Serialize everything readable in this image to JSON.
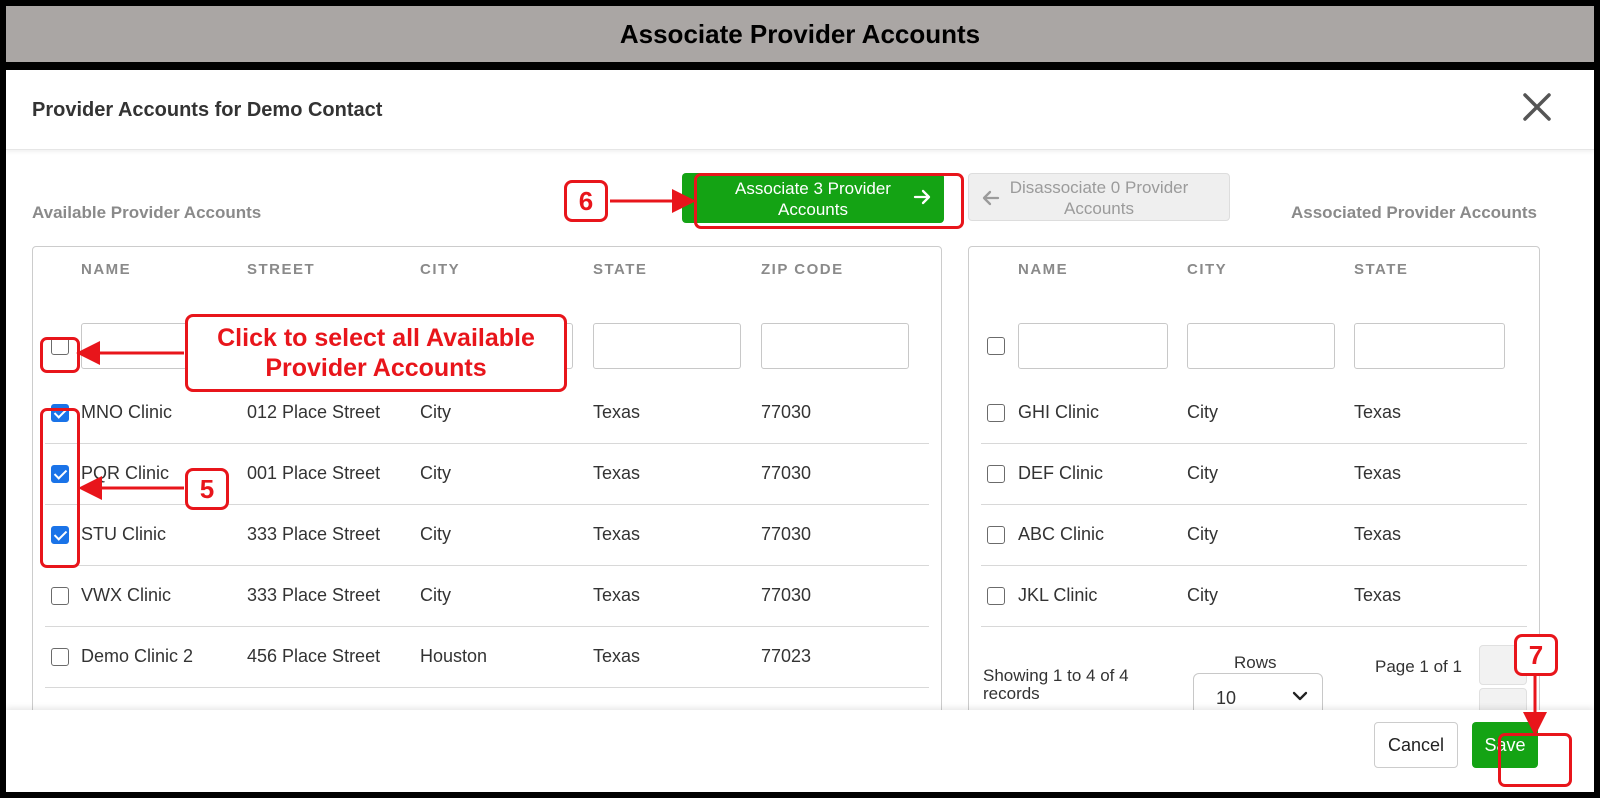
{
  "banner": {
    "title": "Associate Provider Accounts"
  },
  "dialog": {
    "title": "Provider Accounts for Demo Contact",
    "close_icon": "close-icon"
  },
  "available": {
    "label": "Available Provider Accounts",
    "columns": [
      "NAME",
      "STREET",
      "CITY",
      "STATE",
      "ZIP CODE"
    ],
    "rows": [
      {
        "name": "MNO Clinic",
        "street": "012 Place Street",
        "city": "City",
        "state": "Texas",
        "zip": "77030",
        "checked": true
      },
      {
        "name": "PQR Clinic",
        "street": "001 Place Street",
        "city": "City",
        "state": "Texas",
        "zip": "77030",
        "checked": true
      },
      {
        "name": "STU Clinic",
        "street": "333 Place Street",
        "city": "City",
        "state": "Texas",
        "zip": "77030",
        "checked": true
      },
      {
        "name": "VWX Clinic",
        "street": "333 Place Street",
        "city": "City",
        "state": "Texas",
        "zip": "77030",
        "checked": false
      },
      {
        "name": "Demo Clinic 2",
        "street": "456 Place Street",
        "city": "Houston",
        "state": "Texas",
        "zip": "77023",
        "checked": false
      }
    ]
  },
  "associate_button": {
    "label": "Associate 3 Provider Accounts",
    "icon": "arrow-right-icon"
  },
  "disassociate_button": {
    "label": "Disassociate 0 Provider Accounts",
    "icon": "arrow-left-icon"
  },
  "associated": {
    "label": "Associated Provider Accounts",
    "columns": [
      "NAME",
      "CITY",
      "STATE"
    ],
    "rows": [
      {
        "name": "GHI Clinic",
        "city": "City",
        "state": "Texas",
        "checked": false
      },
      {
        "name": "DEF Clinic",
        "city": "City",
        "state": "Texas",
        "checked": false
      },
      {
        "name": "ABC Clinic",
        "city": "City",
        "state": "Texas",
        "checked": false
      },
      {
        "name": "JKL Clinic",
        "city": "City",
        "state": "Texas",
        "checked": false
      }
    ],
    "pager": {
      "showing": "Showing 1 to 4 of 4 records",
      "rows_label": "Rows",
      "rows_value": "10",
      "page_label": "Page 1 of 1"
    }
  },
  "footer": {
    "cancel_label": "Cancel",
    "save_label": "Save"
  },
  "annotations": {
    "select_all_callout": "Click to select all Available Provider Accounts",
    "step_5": "5",
    "step_6": "6",
    "step_7": "7",
    "accent_color": "#e8151b"
  }
}
